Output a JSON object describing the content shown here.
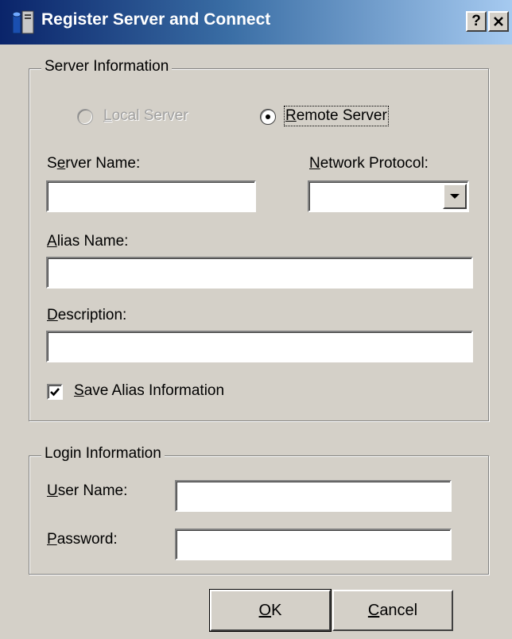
{
  "window": {
    "title": "Register Server and Connect",
    "help_button": "?",
    "close_button": "X"
  },
  "server_info": {
    "legend": "Server Information",
    "local_server": {
      "pre": "",
      "accel": "L",
      "post": "ocal Server",
      "selected": false,
      "enabled": false
    },
    "remote_server": {
      "pre": "",
      "accel": "R",
      "post": "emote Server",
      "selected": true,
      "enabled": true
    },
    "server_name": {
      "pre": "S",
      "accel": "e",
      "post": "rver Name:",
      "value": ""
    },
    "network_protocol": {
      "pre": "",
      "accel": "N",
      "post": "etwork Protocol:",
      "value": ""
    },
    "alias_name": {
      "pre": "",
      "accel": "A",
      "post": "lias Name:",
      "value": ""
    },
    "description": {
      "pre": "",
      "accel": "D",
      "post": "escription:",
      "value": ""
    },
    "save_alias": {
      "pre": "",
      "accel": "S",
      "post": "ave Alias Information",
      "checked": true
    }
  },
  "login_info": {
    "legend": "Login Information",
    "user_name": {
      "pre": "",
      "accel": "U",
      "post": "ser Name:",
      "value": ""
    },
    "password": {
      "pre": "",
      "accel": "P",
      "post": "assword:",
      "value": ""
    }
  },
  "buttons": {
    "ok": {
      "pre": "",
      "accel": "O",
      "post": "K"
    },
    "cancel": {
      "pre": "",
      "accel": "C",
      "post": "ancel"
    }
  },
  "colors": {
    "face": "#d4d0c8",
    "title_start": "#0a246a",
    "title_end": "#a6caf0"
  },
  "icons": {
    "title": "server-app-icon",
    "check": "checkmark-icon",
    "dropdown": "down-arrow-icon"
  }
}
